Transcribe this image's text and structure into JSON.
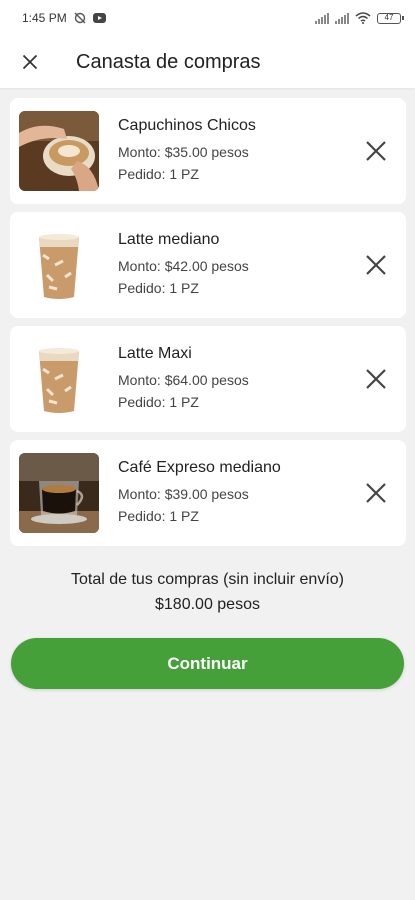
{
  "status_bar": {
    "time": "1:45 PM",
    "battery": "47",
    "icons": [
      "sync-off-icon",
      "youtube-icon",
      "signal-icon",
      "signal-icon",
      "wifi-icon",
      "battery-icon"
    ]
  },
  "header": {
    "close_icon": "close-icon",
    "title": "Canasta de compras"
  },
  "items": [
    {
      "name": "Capuchinos Chicos",
      "amount": "Monto: $35.00 pesos",
      "order": "Pedido: 1 PZ",
      "image": "cappuccino-image"
    },
    {
      "name": "Latte mediano",
      "amount": "Monto: $42.00 pesos",
      "order": "Pedido: 1 PZ",
      "image": "iced-latte-image"
    },
    {
      "name": "Latte Maxi",
      "amount": "Monto: $64.00 pesos",
      "order": "Pedido: 1 PZ",
      "image": "iced-latte-image"
    },
    {
      "name": "Café Expreso mediano",
      "amount": "Monto: $39.00 pesos",
      "order": "Pedido: 1 PZ",
      "image": "espresso-image"
    }
  ],
  "total": {
    "label": "Total de tus compras (sin incluir envío)",
    "amount": "$180.00 pesos"
  },
  "continue_label": "Continuar",
  "colors": {
    "accent": "#46a03a",
    "background": "#f1f1f1",
    "card": "#ffffff"
  }
}
